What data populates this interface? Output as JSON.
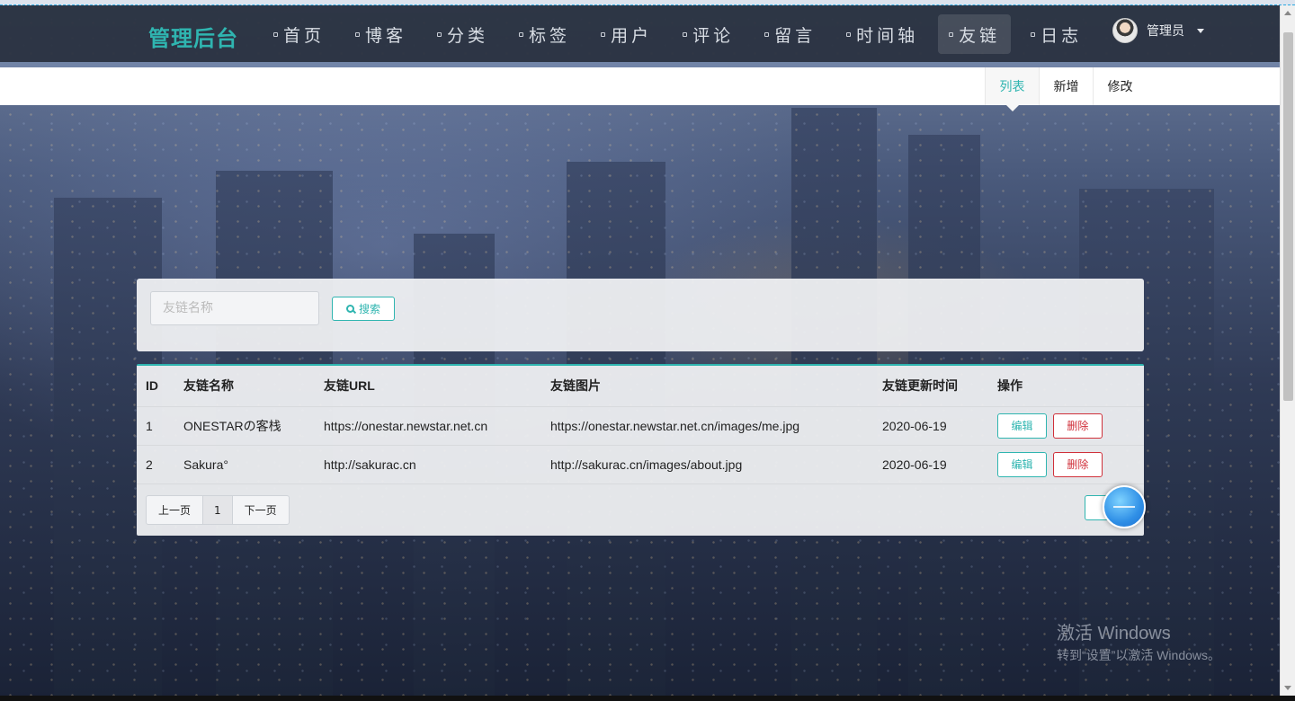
{
  "navbar": {
    "brand": "管理后台",
    "items": [
      {
        "label": "首页",
        "active": false
      },
      {
        "label": "博客",
        "active": false
      },
      {
        "label": "分类",
        "active": false
      },
      {
        "label": "标签",
        "active": false
      },
      {
        "label": "用户",
        "active": false
      },
      {
        "label": "评论",
        "active": false
      },
      {
        "label": "留言",
        "active": false
      },
      {
        "label": "时间轴",
        "active": false
      },
      {
        "label": "友链",
        "active": true
      },
      {
        "label": "日志",
        "active": false
      }
    ],
    "user_name": "管理员"
  },
  "subtabs": [
    {
      "label": "列表",
      "active": true
    },
    {
      "label": "新增",
      "active": false
    },
    {
      "label": "修改",
      "active": false
    }
  ],
  "search": {
    "placeholder": "友链名称",
    "value": "",
    "button_label": "搜索"
  },
  "table": {
    "headers": [
      "ID",
      "友链名称",
      "友链URL",
      "友链图片",
      "友链更新时间",
      "操作"
    ],
    "rows": [
      {
        "id": "1",
        "name": "ONESTARの客栈",
        "url": "https://onestar.newstar.net.cn",
        "image": "https://onestar.newstar.net.cn/images/me.jpg",
        "time": "2020-06-19"
      },
      {
        "id": "2",
        "name": "Sakura°",
        "url": "http://sakurac.cn",
        "image": "http://sakurac.cn/images/about.jpg",
        "time": "2020-06-19"
      }
    ],
    "edit_label": "编辑",
    "delete_label": "删除"
  },
  "pager": {
    "prev_label": "上一页",
    "current_page": "1",
    "next_label": "下一页"
  },
  "watermark": {
    "line1": "激活 Windows",
    "line2": "转到“设置”以激活 Windows。"
  },
  "colors": {
    "accent": "#2fb5b0",
    "danger": "#d0303a",
    "navbar_bg": "#28303e"
  }
}
